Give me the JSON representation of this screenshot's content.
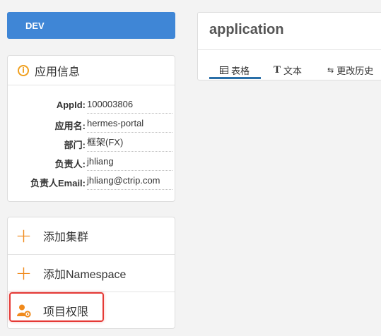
{
  "env": {
    "label": "DEV"
  },
  "app_info": {
    "title": "应用信息",
    "rows": [
      {
        "key": "AppId:",
        "value": "100003806"
      },
      {
        "key": "应用名:",
        "value": "hermes-portal"
      },
      {
        "key": "部门:",
        "value": "框架(FX)"
      },
      {
        "key": "负责人:",
        "value": "jhliang"
      },
      {
        "key": "负责人Email:",
        "value": "jhliang@ctrip.com"
      }
    ]
  },
  "actions": [
    {
      "label": "添加集群"
    },
    {
      "label": "添加Namespace"
    },
    {
      "label": "项目权限"
    }
  ],
  "namespace": {
    "title": "application",
    "tabs": [
      {
        "label": "表格"
      },
      {
        "label": "文本"
      },
      {
        "label": "更改历史"
      }
    ]
  },
  "colors": {
    "accent": "#3f86d6",
    "warn": "#f08a1c",
    "highlight": "#e53935"
  }
}
